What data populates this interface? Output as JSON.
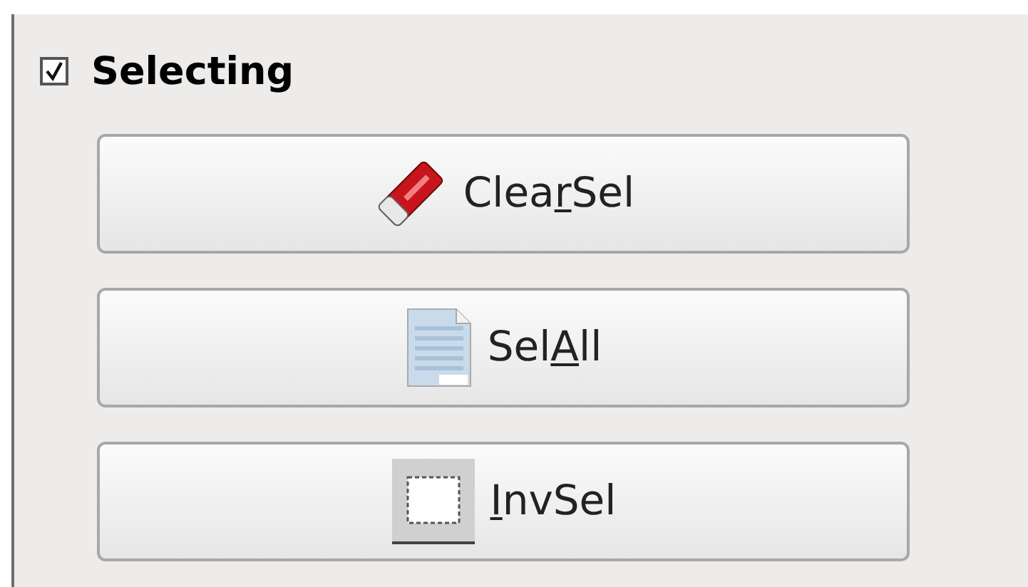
{
  "group": {
    "title": "Selecting",
    "checked": true
  },
  "buttons": [
    {
      "kind": "eraser",
      "text_before": "Clea",
      "mnemonic": "r",
      "text_after": "Sel"
    },
    {
      "kind": "document",
      "text_before": "Sel",
      "mnemonic": "A",
      "text_after": "ll"
    },
    {
      "kind": "selection",
      "mnemonic": "I",
      "text_after": "nvSel"
    }
  ]
}
